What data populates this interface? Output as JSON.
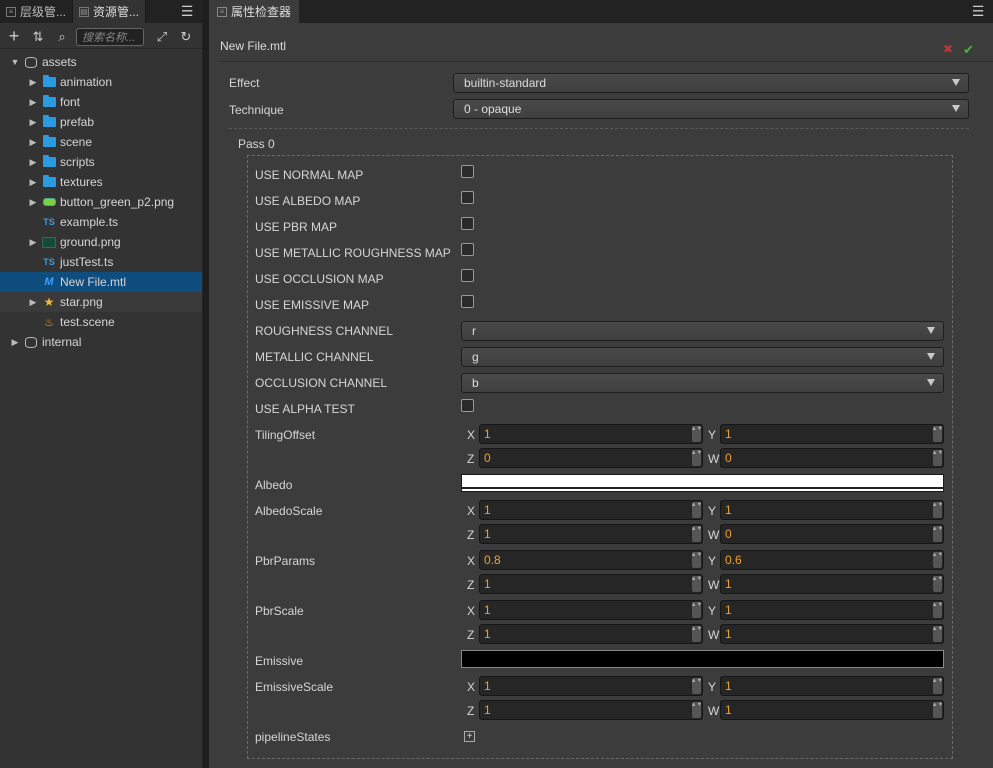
{
  "left_panel": {
    "tabs": [
      {
        "label": "层级管..."
      },
      {
        "label": "资源管..."
      }
    ],
    "search_placeholder": "搜索名称...",
    "tree": [
      {
        "label": "assets",
        "depth": 0,
        "arrow": "down",
        "icon": "database-icon"
      },
      {
        "label": "animation",
        "depth": 1,
        "arrow": "right",
        "icon": "folder-icon"
      },
      {
        "label": "font",
        "depth": 1,
        "arrow": "right",
        "icon": "folder-icon"
      },
      {
        "label": "prefab",
        "depth": 1,
        "arrow": "right",
        "icon": "folder-icon"
      },
      {
        "label": "scene",
        "depth": 1,
        "arrow": "right",
        "icon": "folder-icon"
      },
      {
        "label": "scripts",
        "depth": 1,
        "arrow": "right",
        "icon": "folder-icon"
      },
      {
        "label": "textures",
        "depth": 1,
        "arrow": "right",
        "icon": "folder-icon"
      },
      {
        "label": "button_green_p2.png",
        "depth": 1,
        "arrow": "right",
        "icon": "image-icon"
      },
      {
        "label": "example.ts",
        "depth": 1,
        "arrow": "",
        "icon": "typescript-icon"
      },
      {
        "label": "ground.png",
        "depth": 1,
        "arrow": "right",
        "icon": "image-icon"
      },
      {
        "label": "justTest.ts",
        "depth": 1,
        "arrow": "",
        "icon": "typescript-icon"
      },
      {
        "label": "New File.mtl",
        "depth": 1,
        "arrow": "",
        "icon": "material-icon",
        "selected": true
      },
      {
        "label": "star.png",
        "depth": 1,
        "arrow": "right",
        "icon": "star-icon"
      },
      {
        "label": "test.scene",
        "depth": 1,
        "arrow": "",
        "icon": "scene-icon"
      },
      {
        "label": "internal",
        "depth": 0,
        "arrow": "right",
        "icon": "database-icon"
      }
    ]
  },
  "inspector": {
    "tab_label": "属性检查器",
    "file_name": "New File.mtl",
    "effect_label": "Effect",
    "effect_value": "builtin-standard",
    "technique_label": "Technique",
    "technique_value": "0 - opaque",
    "pass_title": "Pass 0",
    "checkboxes": [
      {
        "label": "USE NORMAL MAP",
        "checked": false
      },
      {
        "label": "USE ALBEDO MAP",
        "checked": false
      },
      {
        "label": "USE PBR MAP",
        "checked": false
      },
      {
        "label": "USE METALLIC ROUGHNESS MAP",
        "checked": false
      },
      {
        "label": "USE OCCLUSION MAP",
        "checked": false
      },
      {
        "label": "USE EMISSIVE MAP",
        "checked": false
      }
    ],
    "channels": [
      {
        "label": "ROUGHNESS CHANNEL",
        "value": "r"
      },
      {
        "label": "METALLIC CHANNEL",
        "value": "g"
      },
      {
        "label": "OCCLUSION CHANNEL",
        "value": "b"
      }
    ],
    "alpha_test_label": "USE ALPHA TEST",
    "tiling_offset": {
      "label": "TilingOffset",
      "x": "1",
      "y": "1",
      "z": "0",
      "w": "0"
    },
    "albedo": {
      "label": "Albedo",
      "color": "#ffffff"
    },
    "albedo_scale": {
      "label": "AlbedoScale",
      "x": "1",
      "y": "1",
      "z": "1",
      "w": "0"
    },
    "pbr_params": {
      "label": "PbrParams",
      "x": "0.8",
      "y": "0.6",
      "z": "1",
      "w": "1"
    },
    "pbr_scale": {
      "label": "PbrScale",
      "x": "1",
      "y": "1",
      "z": "1",
      "w": "1"
    },
    "emissive": {
      "label": "Emissive",
      "color": "#000000"
    },
    "emissive_scale": {
      "label": "EmissiveScale",
      "x": "1",
      "y": "1",
      "z": "1",
      "w": "1"
    },
    "pipeline_states_label": "pipelineStates",
    "axis_labels": {
      "x": "X",
      "y": "Y",
      "z": "Z",
      "w": "W"
    }
  }
}
